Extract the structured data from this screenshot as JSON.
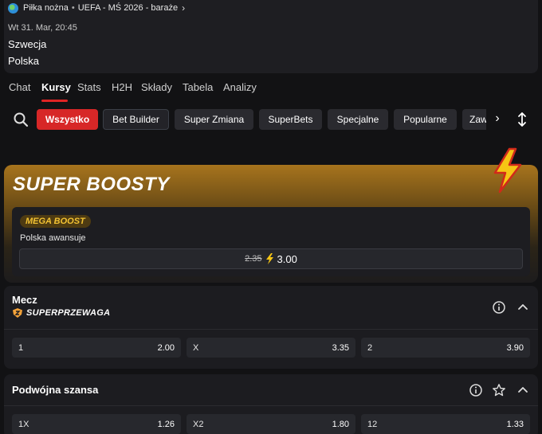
{
  "header": {
    "breadcrumb": [
      "Piłka nożna",
      "UEFA - MŚ 2026 - baraże"
    ],
    "breadcrumb_sep": "•",
    "date": "Wt 31. Mar, 20:45",
    "team_home": "Szwecja",
    "team_away": "Polska"
  },
  "tabs": [
    "Chat",
    "Kursy",
    "Stats",
    "H2H",
    "Składy",
    "Tabela",
    "Analizy"
  ],
  "active_tab": "Kursy",
  "filters": {
    "chips": [
      "Wszystko",
      "Bet Builder",
      "Super Zmiana",
      "SuperBets",
      "Specjalne",
      "Popularne",
      "Zaw"
    ],
    "active": "Wszystko"
  },
  "super_boosty": {
    "title": "SUPER BOOSTY",
    "badge": "MEGA BOOST",
    "description": "Polska awansuje",
    "old_odd": "2.35",
    "new_odd": "3.00"
  },
  "markets": [
    {
      "title": "Mecz",
      "tag": "SUPERPRZEWAGA",
      "outcomes": [
        {
          "label": "1",
          "odd": "2.00"
        },
        {
          "label": "X",
          "odd": "3.35"
        },
        {
          "label": "2",
          "odd": "3.90"
        }
      ]
    },
    {
      "title": "Podwójna szansa",
      "outcomes": [
        {
          "label": "1X",
          "odd": "1.26"
        },
        {
          "label": "X2",
          "odd": "1.80"
        },
        {
          "label": "12",
          "odd": "1.33"
        }
      ]
    }
  ],
  "colors": {
    "accent_red": "#d72727",
    "gold": "#f2c233",
    "bg": "#121214",
    "card": "#1c1c20"
  },
  "icons": [
    "globe-icon",
    "chevron-right-icon",
    "search-icon",
    "sort-icon",
    "lightning-bolt-icon",
    "shield-icon",
    "info-icon",
    "chevron-up-icon",
    "star-icon"
  ]
}
